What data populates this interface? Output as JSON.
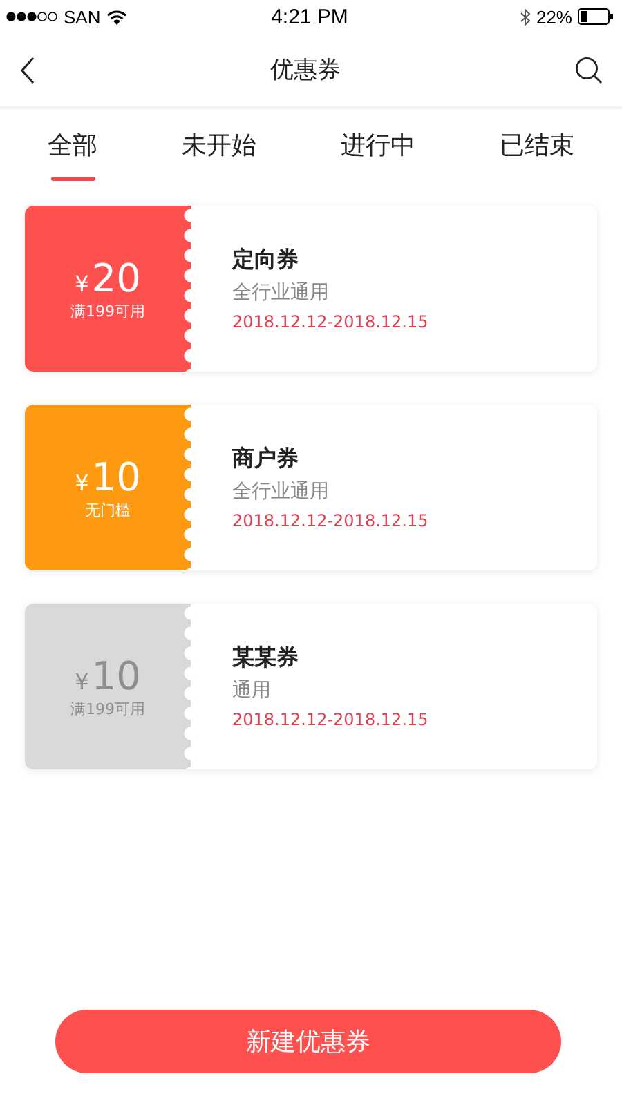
{
  "status_bar": {
    "carrier": "SAN",
    "time": "4:21 PM",
    "battery": "22%"
  },
  "nav": {
    "title": "优惠券"
  },
  "tabs": [
    {
      "label": "全部",
      "selected": true
    },
    {
      "label": "未开始",
      "selected": false
    },
    {
      "label": "进行中",
      "selected": false
    },
    {
      "label": "已结束",
      "selected": false
    }
  ],
  "coupons": [
    {
      "currency": "¥",
      "amount": "20",
      "condition": "满199可用",
      "color": "#ff5050",
      "name": "定向券",
      "scope": "全行业通用",
      "period": "2018.12.12-2018.12.15"
    },
    {
      "currency": "¥",
      "amount": "10",
      "condition": "无门槛",
      "color": "#fe9a12",
      "name": "商户券",
      "scope": "全行业通用",
      "period": "2018.12.12-2018.12.15"
    },
    {
      "currency": "¥",
      "amount": "10",
      "condition": "满199可用",
      "color": "#d9d9d9",
      "name": "某某券",
      "scope": "通用",
      "period": "2018.12.12-2018.12.15"
    }
  ],
  "primary_button": "新建优惠券"
}
